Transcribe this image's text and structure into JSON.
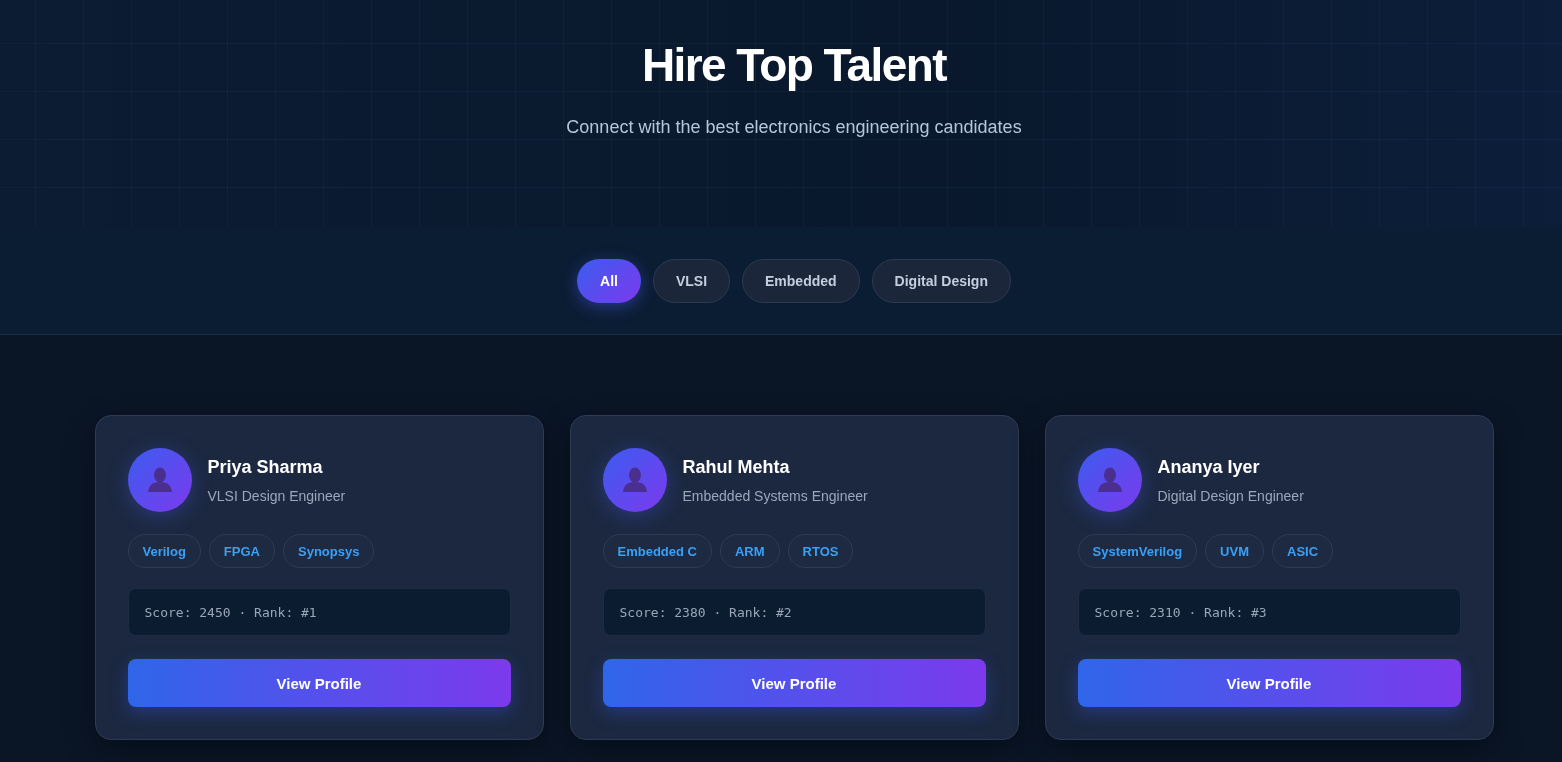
{
  "header": {
    "title": "Hire Top Talent",
    "subtitle": "Connect with the best electronics engineering candidates"
  },
  "filters": [
    {
      "label": "All",
      "selected": true
    },
    {
      "label": "VLSI",
      "selected": false
    },
    {
      "label": "Embedded",
      "selected": false
    },
    {
      "label": "Digital Design",
      "selected": false
    }
  ],
  "candidates": [
    {
      "name": "Priya Sharma",
      "role": "VLSI Design Engineer",
      "skills": [
        "Verilog",
        "FPGA",
        "Synopsys"
      ],
      "stats": "Score: 2450 · Rank: #1",
      "action": "View Profile"
    },
    {
      "name": "Rahul Mehta",
      "role": "Embedded Systems Engineer",
      "skills": [
        "Embedded C",
        "ARM",
        "RTOS"
      ],
      "stats": "Score: 2380 · Rank: #2",
      "action": "View Profile"
    },
    {
      "name": "Ananya Iyer",
      "role": "Digital Design Engineer",
      "skills": [
        "SystemVerilog",
        "UVM",
        "ASIC"
      ],
      "stats": "Score: 2310 · Rank: #3",
      "action": "View Profile"
    }
  ]
}
